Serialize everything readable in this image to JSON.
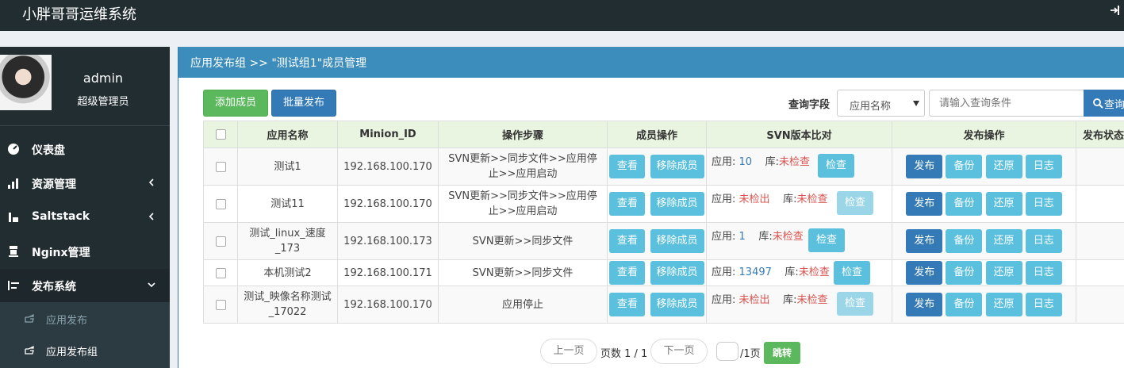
{
  "app_title": "小胖哥哥运维系统",
  "user": {
    "name": "admin",
    "role": "超级管理员"
  },
  "sidebar": {
    "items": [
      {
        "label": "仪表盘",
        "icon": "dashboard-icon"
      },
      {
        "label": "资源管理",
        "icon": "resource-icon"
      },
      {
        "label": "Saltstack",
        "icon": "saltstack-icon"
      },
      {
        "label": "Nginx管理",
        "icon": "nginx-icon"
      },
      {
        "label": "发布系统",
        "icon": "release-icon"
      }
    ],
    "sub_items": [
      {
        "label": "应用发布"
      },
      {
        "label": "应用发布组"
      }
    ]
  },
  "panel": {
    "title": "应用发布组 >> \"测试组1\"成员管理"
  },
  "toolbar": {
    "add_label": "添加成员",
    "batch_label": "批量发布",
    "query_label": "查询字段",
    "query_field": "应用名称",
    "query_placeholder": "请输入查询条件",
    "query_button": "查询"
  },
  "table": {
    "headers": [
      "",
      "应用名称",
      "Minion_ID",
      "操作步骤",
      "成员操作",
      "SVN版本比对",
      "发布操作",
      "发布状态"
    ],
    "rows": [
      {
        "name": "测试1",
        "minion": "192.168.100.170",
        "steps": "SVN更新>>同步文件>>应用停止>>应用启动",
        "app_label": "应用:",
        "app_ver": "10",
        "lib_label": "库:",
        "lib_ver": "未检查"
      },
      {
        "name": "测试11",
        "minion": "192.168.100.170",
        "steps": "SVN更新>>同步文件>>应用停止>>应用启动",
        "app_label": "应用:",
        "app_ver": "未检出",
        "lib_label": "库:",
        "lib_ver": "未检查"
      },
      {
        "name": "测试_linux_速度_173",
        "minion": "192.168.100.173",
        "steps": "SVN更新>>同步文件",
        "app_label": "应用:",
        "app_ver": "1",
        "lib_label": "库:",
        "lib_ver": "未检查"
      },
      {
        "name": "本机测试2",
        "minion": "192.168.100.171",
        "steps": "SVN更新>>同步文件",
        "app_label": "应用:",
        "app_ver": "13497",
        "lib_label": "库:",
        "lib_ver": "未检查"
      },
      {
        "name": "测试_映像名称测试_17022",
        "minion": "192.168.100.170",
        "steps": "应用停止",
        "app_label": "应用:",
        "app_ver": "未检出",
        "lib_label": "库:",
        "lib_ver": "未检查"
      }
    ],
    "member_buttons": {
      "view": "查看",
      "remove": "移除成员"
    },
    "check_button": "检查",
    "release_buttons": {
      "publish": "发布",
      "backup": "备份",
      "restore": "还原",
      "log": "日志"
    }
  },
  "pagination": {
    "prev": "上一页",
    "page_info": "页数 1 / 1",
    "next": "下一页",
    "total_pages": "/1页",
    "go": "跳转"
  },
  "colors": {
    "topbar": "#222d32",
    "panel_header": "#3c8dbc",
    "primary": "#337ab7",
    "success": "#5cb85c",
    "info": "#5bc0de"
  }
}
